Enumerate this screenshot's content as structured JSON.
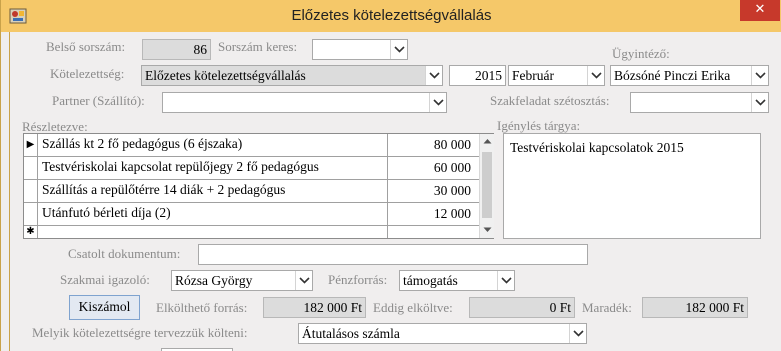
{
  "window": {
    "title": "Előzetes kötelezettségvállalás",
    "close": "✕"
  },
  "form": {
    "belso_sorszam": {
      "label": "Belső sorszám:",
      "value": "86"
    },
    "sorszam_keres": {
      "label": "Sorszám keres:",
      "value": ""
    },
    "ugyintezo": {
      "label": "Ügyintéző:",
      "value": "Bózsóné Pinczi Erika"
    },
    "kotelezettseg": {
      "label": "Kötelezettség:",
      "value": "Előzetes kötelezettségvállalás"
    },
    "ev": {
      "value": "2015"
    },
    "honap": {
      "value": "Február"
    },
    "partner": {
      "label": "Partner (Szállító):",
      "value": ""
    },
    "szakfeladat": {
      "label": "Szakfeladat szétosztás:",
      "value": ""
    },
    "reszletezve": {
      "label": "Részletezve:"
    },
    "igenyles": {
      "label": "Igénylés tárgya:",
      "value": "Testvériskolai kapcsolatok 2015"
    },
    "csatolt": {
      "label": "Csatolt dokumentum:",
      "value": ""
    },
    "szakmai": {
      "label": "Szakmai igazoló:",
      "value": "Rózsa György"
    },
    "penzforras": {
      "label": "Pénzforrás:",
      "value": "támogatás"
    },
    "kiszamol": {
      "label": "Kiszámol"
    },
    "elkoltheto": {
      "label": "Elkölthető forrás:",
      "value": "182 000 Ft"
    },
    "eddig": {
      "label": "Eddig elköltve:",
      "value": "0 Ft"
    },
    "maradek": {
      "label": "Maradék:",
      "value": "182 000 Ft"
    },
    "melyik": {
      "label": "Melyik kötelezettségre tervezzük költeni:",
      "value": "Átutalásos számla"
    }
  },
  "table": {
    "rows": [
      {
        "marker": "▶",
        "desc": "Szállás kt 2 fő pedagógus (6 éjszaka)",
        "amount": "80 000"
      },
      {
        "marker": "",
        "desc": "Testvériskolai kapcsolat repülőjegy 2 fő pedagógus",
        "amount": "60 000"
      },
      {
        "marker": "",
        "desc": "Szállítás a repülőtérre 14 diák + 2 pedagógus",
        "amount": "30 000"
      },
      {
        "marker": "",
        "desc": "Utánfutó bérleti díja (2)",
        "amount": "12 000"
      },
      {
        "marker": "✱",
        "desc": "",
        "amount": ""
      }
    ]
  },
  "colors": {
    "titlebar": "#f5c869",
    "form_bg": "#f0eeee",
    "close": "#c7392b"
  }
}
